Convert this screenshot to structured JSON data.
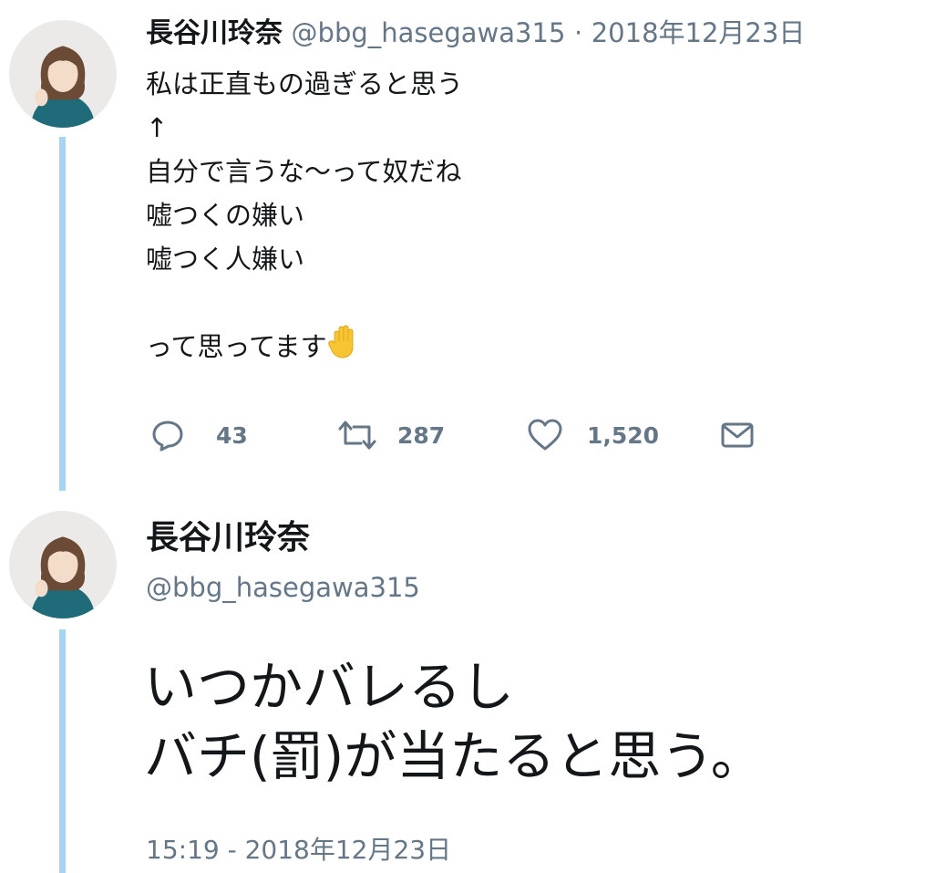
{
  "tweets": [
    {
      "name": "長谷川玲奈",
      "handle": "@bbg_hasegawa315",
      "separator": "·",
      "date": "2018年12月23日",
      "lines": [
        "私は正直もの過ぎると思う",
        "↑",
        "自分で言うな〜って奴だね",
        "嘘つくの嫌い",
        "嘘つく人嫌い",
        "",
        "って思ってます"
      ],
      "emoji": "raised-hand",
      "actions": {
        "replies": "43",
        "retweets": "287",
        "likes": "1,520"
      }
    },
    {
      "name": "長谷川玲奈",
      "handle": "@bbg_hasegawa315",
      "lines": [
        "いつかバレるし",
        "バチ(罰)が当たると思う。"
      ],
      "timestamp": "15:19 - 2018年12月23日"
    }
  ],
  "icons": {
    "reply": "reply-icon",
    "retweet": "retweet-icon",
    "like": "like-icon",
    "message": "message-icon"
  },
  "colors": {
    "thread_line": "#a7d4f1",
    "secondary_text": "#657786",
    "primary_text": "#14171a"
  }
}
